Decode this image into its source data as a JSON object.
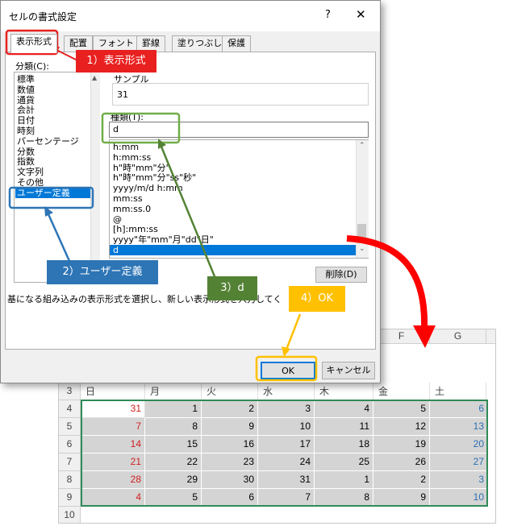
{
  "sheet": {
    "columns": [
      "F",
      "G"
    ],
    "day_headers": [
      "日",
      "月",
      "火",
      "水",
      "木",
      "金",
      "土"
    ],
    "rows": [
      {
        "row": "3",
        "values": []
      },
      {
        "row": "4",
        "values": [
          "31",
          "1",
          "2",
          "3",
          "4",
          "5",
          "6"
        ]
      },
      {
        "row": "5",
        "values": [
          "7",
          "8",
          "9",
          "10",
          "11",
          "12",
          "13"
        ]
      },
      {
        "row": "6",
        "values": [
          "14",
          "15",
          "16",
          "17",
          "18",
          "19",
          "20"
        ]
      },
      {
        "row": "7",
        "values": [
          "21",
          "22",
          "23",
          "24",
          "25",
          "26",
          "27"
        ]
      },
      {
        "row": "8",
        "values": [
          "28",
          "29",
          "30",
          "31",
          "1",
          "2",
          "3"
        ]
      },
      {
        "row": "9",
        "values": [
          "4",
          "5",
          "6",
          "7",
          "8",
          "9",
          "10"
        ]
      },
      {
        "row": "10",
        "values": []
      }
    ],
    "colors": {
      "sunday": "#d02020",
      "saturday": "#2a6fb5",
      "selection": "#d4d4d4",
      "range_border": "#2e8b57"
    }
  },
  "dialog": {
    "title": "セルの書式設定",
    "help": "?",
    "close": "✕",
    "tabs": [
      "表示形式",
      "配置",
      "フォント",
      "罫線",
      "塗りつぶし",
      "保護"
    ],
    "category_label": "分類(C):",
    "categories": [
      "標準",
      "数値",
      "通貨",
      "会計",
      "日付",
      "時刻",
      "パーセンテージ",
      "分数",
      "指数",
      "文字列",
      "その他",
      "ユーザー定義"
    ],
    "selected_category": "ユーザー定義",
    "sample_label": "サンプル",
    "sample_value": "31",
    "type_label": "種類(T):",
    "type_value": "d",
    "formats": [
      "h:mm",
      "h:mm:ss",
      "h\"時\"mm\"分\"",
      "h\"時\"mm\"分\"ss\"秒\"",
      "yyyy/m/d h:mm",
      "mm:ss",
      "mm:ss.0",
      "@",
      "[h]:mm:ss",
      "yyyy\"年\"mm\"月\"dd\"日\"",
      "d"
    ],
    "delete_button": "削除(D)",
    "description": "基になる組み込みの表示形式を選択し、新しい表示形式を入力してください。",
    "ok_button": "OK",
    "cancel_button": "キャンセル"
  },
  "annotations": {
    "step1": "1）表示形式",
    "step2": "2）ユーザー定義",
    "step3": "3）d",
    "step4": "4）OK",
    "colors": {
      "red": "#e8201f",
      "blue": "#2e75b6",
      "green": "#548235",
      "orange": "#ffc000"
    }
  }
}
